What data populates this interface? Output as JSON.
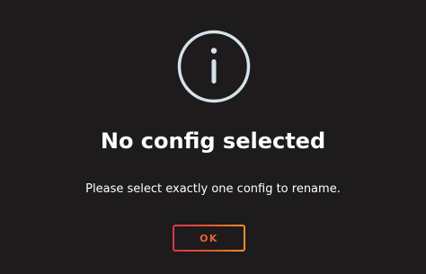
{
  "dialog": {
    "icon": "info-icon",
    "title": "No config selected",
    "message": "Please select exactly one config to rename.",
    "ok_label": "OK"
  },
  "colors": {
    "background": "#1d1b1c",
    "icon_stroke": "#d4e3ea",
    "text": "#ffffff",
    "button_gradient_start": "#d9374f",
    "button_gradient_end": "#f29024",
    "button_text": "#e8613a"
  }
}
